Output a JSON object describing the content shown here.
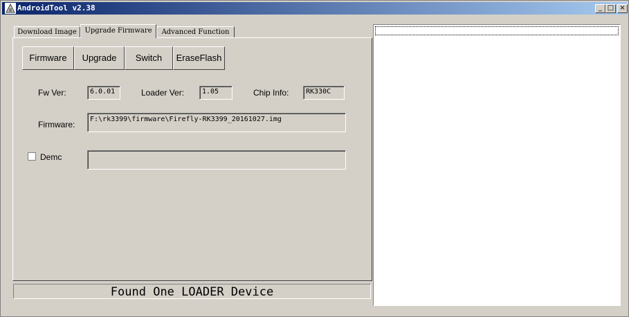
{
  "window": {
    "title": "AndroidTool v2.38",
    "controls": {
      "minimize": "_",
      "maximize": "□",
      "close": "×"
    }
  },
  "tabs": [
    {
      "label": "Download Image",
      "active": false
    },
    {
      "label": "Upgrade Firmware",
      "active": true
    },
    {
      "label": "Advanced Function",
      "active": false
    }
  ],
  "buttons": {
    "firmware": "Firmware",
    "upgrade": "Upgrade",
    "switch": "Switch",
    "erase": "EraseFlash"
  },
  "info": {
    "fw_ver_label": "Fw Ver:",
    "fw_ver_value": "6.0.01",
    "loader_ver_label": "Loader Ver:",
    "loader_ver_value": "1.05",
    "chip_info_label": "Chip Info:",
    "chip_info_value": "RK330C",
    "firmware_label": "Firmware:",
    "firmware_path": "F:\\rk3399\\firmware\\Firefly-RK3399_20161027.img"
  },
  "demo": {
    "label": "Demc",
    "checked": false,
    "value": ""
  },
  "status": {
    "text": "Found One LOADER Device"
  },
  "colors": {
    "titlebar_start": "#0a246a",
    "titlebar_end": "#a6caf0",
    "face": "#d4d0c8"
  },
  "icons": {
    "app": "android-tool-icon"
  }
}
